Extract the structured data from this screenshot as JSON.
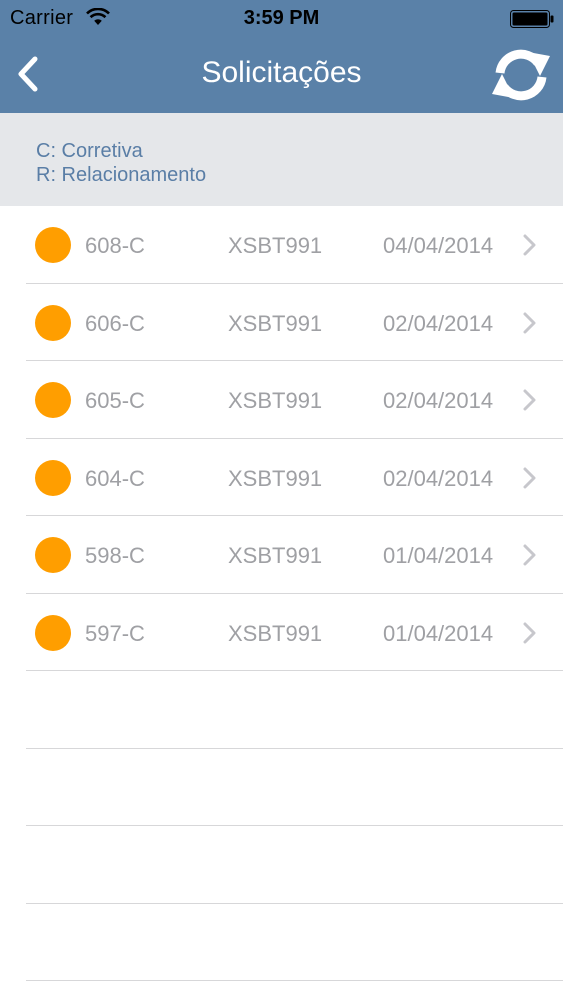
{
  "status_bar": {
    "carrier": "Carrier",
    "time": "3:59 PM",
    "wifi_icon": "wifi-icon",
    "battery_icon": "battery-icon"
  },
  "nav": {
    "title": "Solicitações",
    "back_icon": "chevron-left-icon",
    "refresh_icon": "refresh-icon"
  },
  "legend": {
    "line1": "C: Corretiva",
    "line2": "R: Relacionamento"
  },
  "colors": {
    "header": "#5a81a8",
    "legend_bg": "#e5e7ea",
    "legend_text": "#5a7ea6",
    "status_dot": "#ff9e00",
    "row_text": "#9fa0a4"
  },
  "requests": [
    {
      "id": "608-C",
      "plate": "XSBT991",
      "date": "04/04/2014"
    },
    {
      "id": "606-C",
      "plate": "XSBT991",
      "date": "02/04/2014"
    },
    {
      "id": "605-C",
      "plate": "XSBT991",
      "date": "02/04/2014"
    },
    {
      "id": "604-C",
      "plate": "XSBT991",
      "date": "02/04/2014"
    },
    {
      "id": "598-C",
      "plate": "XSBT991",
      "date": "01/04/2014"
    },
    {
      "id": "597-C",
      "plate": "XSBT991",
      "date": "01/04/2014"
    }
  ]
}
